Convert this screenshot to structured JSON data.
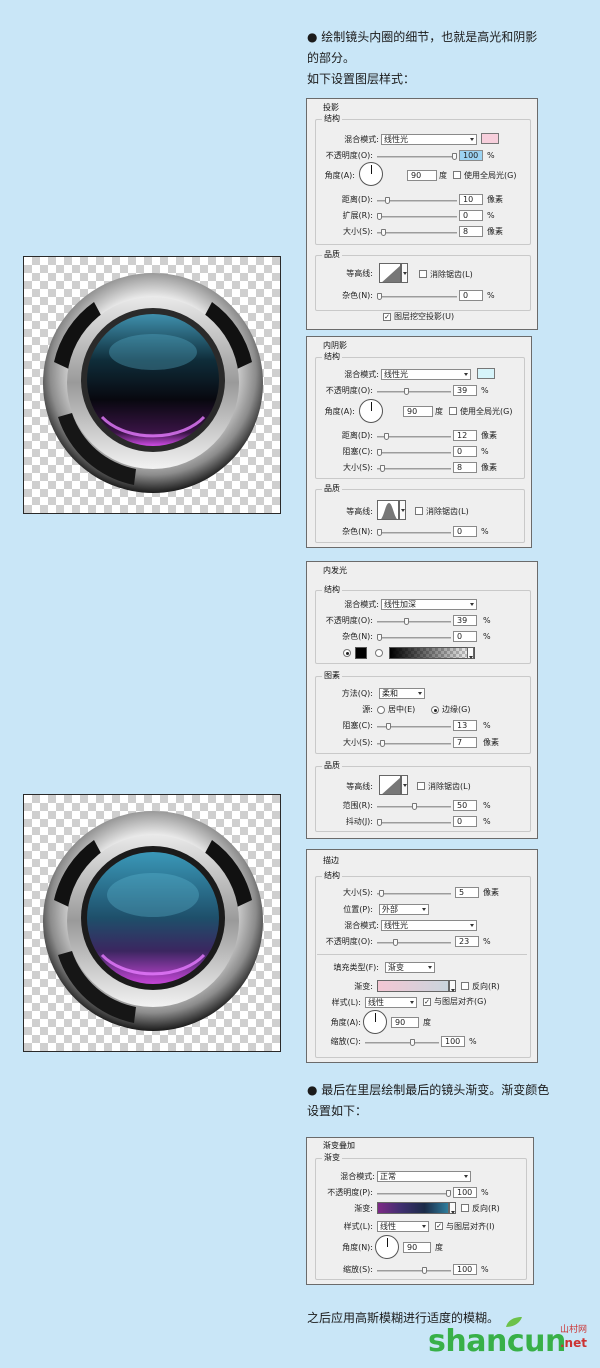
{
  "para1": {
    "line1": "● 绘制镜头内圈的细节，也就是高光和阴影",
    "line2": "的部分。",
    "line3": "如下设置图层样式："
  },
  "para2": {
    "line1": "● 最后在里层绘制最后的镜头渐变。渐变颜色",
    "line2": "设置如下："
  },
  "para3": "之后应用高斯模糊进行适度的模糊。",
  "dropShadow": {
    "title": "投影",
    "group1": "结构",
    "blendLabel": "混合模式:",
    "blendValue": "线性光",
    "blendColor": "#f7cfdc",
    "opacityLabel": "不透明度(O):",
    "opacityValue": "100",
    "opacityFraction": 1.0,
    "angleLabel": "角度(A):",
    "angleValue": "90",
    "angleUnit": "度",
    "globalLight": "使用全局光(G)",
    "distanceLabel": "距离(D):",
    "distanceValue": "10",
    "distanceFraction": 0.1,
    "spreadLabel": "扩展(R):",
    "spreadValue": "0",
    "spreadFraction": 0,
    "sizeLabel": "大小(S):",
    "sizeValue": "8",
    "sizeFraction": 0.05,
    "group2": "品质",
    "contourLabel": "等高线:",
    "antiAlias": "消除锯齿(L)",
    "noiseLabel": "杂色(N):",
    "noiseValue": "0",
    "noiseFraction": 0,
    "knockout": "图层挖空投影(U)",
    "px": "像素",
    "pct": "%"
  },
  "innerShadow": {
    "title": "内阴影",
    "group1": "结构",
    "blendLabel": "混合模式:",
    "blendValue": "线性光",
    "blendColor": "#d6f4fa",
    "opacityLabel": "不透明度(O):",
    "opacityValue": "39",
    "opacityFraction": 0.39,
    "angleLabel": "角度(A):",
    "angleValue": "90",
    "angleUnit": "度",
    "globalLight": "使用全局光(G)",
    "distanceLabel": "距离(D):",
    "distanceValue": "12",
    "distanceFraction": 0.1,
    "chokeLabel": "阻塞(C):",
    "chokeValue": "0",
    "chokeFraction": 0,
    "sizeLabel": "大小(S):",
    "sizeValue": "8",
    "sizeFraction": 0.05,
    "group2": "品质",
    "contourLabel": "等高线:",
    "antiAlias": "消除锯齿(L)",
    "noiseLabel": "杂色(N):",
    "noiseValue": "0",
    "noiseFraction": 0,
    "px": "像素",
    "pct": "%"
  },
  "innerGlow": {
    "title": "内发光",
    "group1": "结构",
    "blendLabel": "混合模式:",
    "blendValue": "线性加深",
    "opacityLabel": "不透明度(O):",
    "opacityValue": "39",
    "opacityFraction": 0.39,
    "noiseLabel": "杂色(N):",
    "noiseValue": "0",
    "noiseFraction": 0,
    "group2": "图素",
    "methodLabel": "方法(Q):",
    "methodValue": "柔和",
    "sourceLabel": "源:",
    "sourceCenter": "居中(E)",
    "sourceEdge": "边缘(G)",
    "chokeLabel": "阻塞(C):",
    "chokeValue": "13",
    "chokeFraction": 0.13,
    "sizeLabel": "大小(S):",
    "sizeValue": "7",
    "sizeFraction": 0.05,
    "group3": "品质",
    "contourLabel": "等高线:",
    "antiAlias": "消除锯齿(L)",
    "rangeLabel": "范围(R):",
    "rangeValue": "50",
    "rangeFraction": 0.5,
    "jitterLabel": "抖动(J):",
    "jitterValue": "0",
    "jitterFraction": 0,
    "px": "像素",
    "pct": "%"
  },
  "stroke": {
    "title": "描边",
    "group1": "结构",
    "sizeLabel": "大小(S):",
    "sizeValue": "5",
    "sizeFraction": 0.03,
    "positionLabel": "位置(P):",
    "positionValue": "外部",
    "blendLabel": "混合模式:",
    "blendValue": "线性光",
    "opacityLabel": "不透明度(O):",
    "opacityValue": "23",
    "opacityFraction": 0.23,
    "fillTypeLabel": "填充类型(F):",
    "fillTypeValue": "渐变",
    "gradientLabel": "渐变:",
    "reverse": "反向(R)",
    "styleLabel": "样式(L):",
    "styleValue": "线性",
    "align": "与图层对齐(G)",
    "angleLabel": "角度(A):",
    "angleValue": "90",
    "angleUnit": "度",
    "scaleLabel": "缩放(C):",
    "scaleValue": "100",
    "scaleFraction": 0.65,
    "px": "像素",
    "pct": "%"
  },
  "gradientOverlay": {
    "title": "渐变叠加",
    "group1": "渐变",
    "blendLabel": "混合模式:",
    "blendValue": "正常",
    "opacityLabel": "不透明度(P):",
    "opacityValue": "100",
    "opacityFraction": 1.0,
    "gradientLabel": "渐变:",
    "reverse": "反向(R)",
    "styleLabel": "样式(L):",
    "styleValue": "线性",
    "align": "与图层对齐(I)",
    "angleLabel": "角度(N):",
    "angleValue": "90",
    "angleUnit": "度",
    "scaleLabel": "缩放(S):",
    "scaleValue": "100",
    "scaleFraction": 0.65,
    "pct": "%"
  },
  "logo": {
    "main": "shancun",
    "sub": "山村网",
    "net": ".net"
  }
}
